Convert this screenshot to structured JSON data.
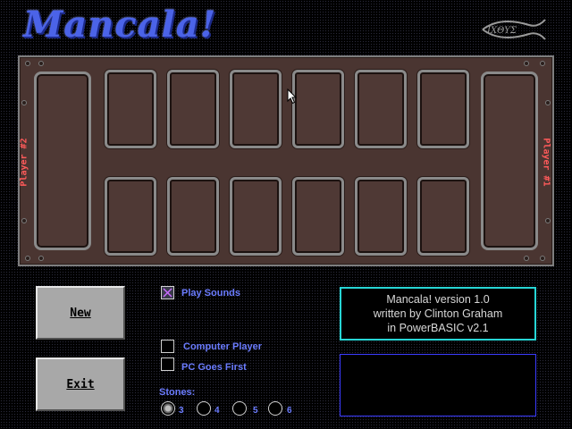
{
  "title": "Mancala!",
  "logo": {
    "text": "ΙΧΘΥΣ",
    "icon": "ichthys-fish-icon"
  },
  "board": {
    "player2_label": "Player #2",
    "player1_label": "Player #1",
    "top_pits": 6,
    "bottom_pits": 6
  },
  "buttons": {
    "new": "New",
    "exit": "Exit"
  },
  "options": {
    "play_sounds": {
      "label": "Play Sounds",
      "checked": true
    },
    "computer_player": {
      "label": "Computer Player",
      "checked": false
    },
    "pc_goes_first": {
      "label": "PC Goes First",
      "checked": false
    }
  },
  "stones": {
    "label": "Stones:",
    "choices": [
      "3",
      "4",
      "5",
      "6"
    ],
    "selected": "3"
  },
  "info": {
    "line1": "Mancala! version 1.0",
    "line2": "written by Clinton Graham",
    "line3": "in PowerBASIC v2.1"
  },
  "message": "",
  "colors": {
    "title": "#4b63e8",
    "board": "#4a3531",
    "info_border": "#27d6d6",
    "message_border": "#3b3bff",
    "player_label": "#ff5a5a"
  }
}
